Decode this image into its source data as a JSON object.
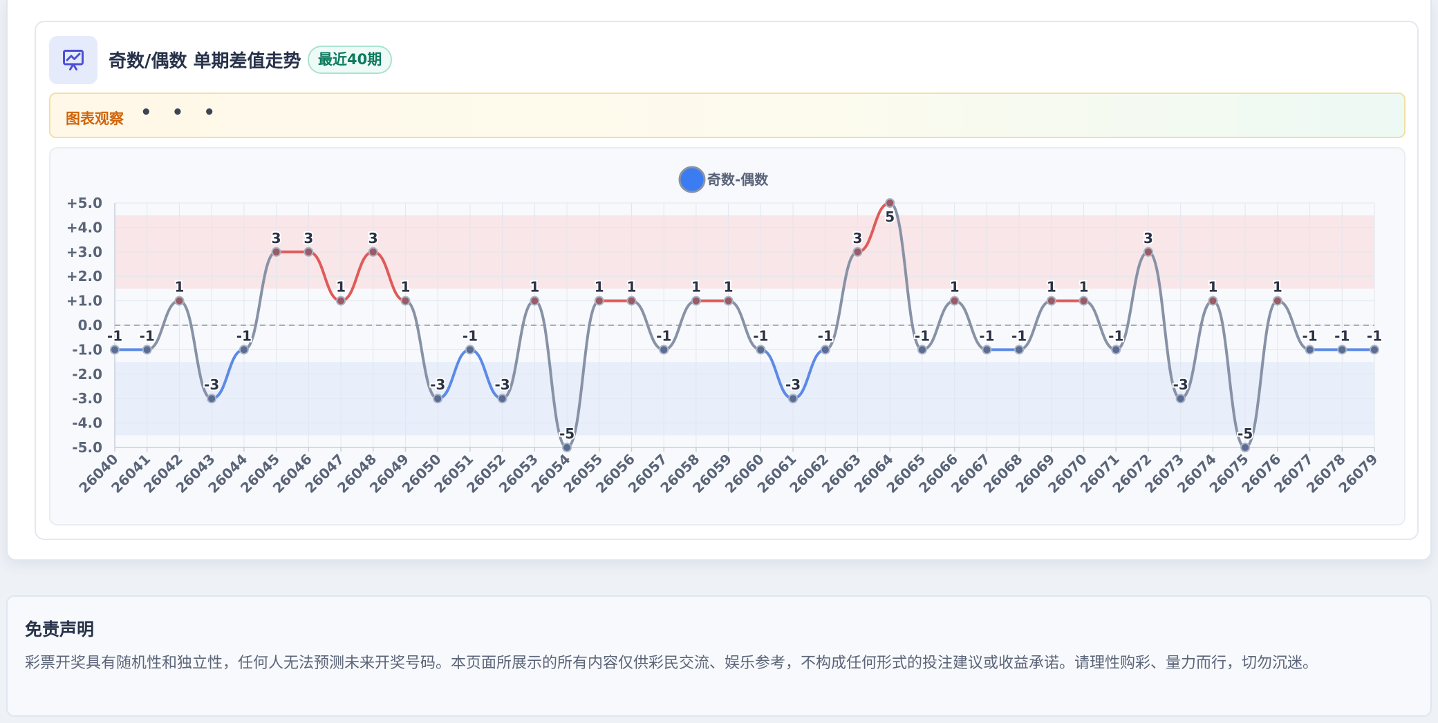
{
  "header": {
    "icon": "presentation-chart-icon",
    "title": "奇数/偶数 单期差值走势",
    "badge": "最近40期"
  },
  "observation": {
    "label": "图表观察",
    "dots": "• • •"
  },
  "colors": {
    "up_line": "#e05a5a",
    "down_line": "#5b8ae6",
    "neutral_line": "#8892a6",
    "legend_dot": "#3b7cf3",
    "high_band": "#f7e3e6",
    "low_band": "#e5ecfa"
  },
  "chart_data": {
    "type": "line",
    "legend": [
      "奇数-偶数"
    ],
    "legend_position": "top-center",
    "x": [
      "26040",
      "26041",
      "26042",
      "26043",
      "26044",
      "26045",
      "26046",
      "26047",
      "26048",
      "26049",
      "26050",
      "26051",
      "26052",
      "26053",
      "26054",
      "26055",
      "26056",
      "26057",
      "26058",
      "26059",
      "26060",
      "26061",
      "26062",
      "26063",
      "26064",
      "26065",
      "26066",
      "26067",
      "26068",
      "26069",
      "26070",
      "26071",
      "26072",
      "26073",
      "26074",
      "26075",
      "26076",
      "26077",
      "26078",
      "26079"
    ],
    "series": [
      {
        "name": "奇数-偶数",
        "values": [
          -1,
          -1,
          1,
          -3,
          -1,
          3,
          3,
          1,
          3,
          1,
          -3,
          -1,
          -3,
          1,
          -5,
          1,
          1,
          -1,
          1,
          1,
          -1,
          -3,
          -1,
          3,
          5,
          -1,
          1,
          -1,
          -1,
          1,
          1,
          -1,
          3,
          -3,
          1,
          -5,
          1,
          -1,
          -1,
          -1
        ]
      }
    ],
    "y_ticks": [
      "+5.0",
      "+4.0",
      "+3.0",
      "+2.0",
      "+1.0",
      "0.0",
      "-1.0",
      "-2.0",
      "-3.0",
      "-4.0",
      "-5.0"
    ],
    "ylim": [
      -5,
      5
    ],
    "bands": [
      {
        "from": 1.5,
        "to": 4.5,
        "kind": "high"
      },
      {
        "from": -4.5,
        "to": -1.5,
        "kind": "low"
      }
    ],
    "zero_line": true,
    "grid": true
  },
  "disclaimer": {
    "title": "免责声明",
    "text": "彩票开奖具有随机性和独立性，任何人无法预测未来开奖号码。本页面所展示的所有内容仅供彩民交流、娱乐参考，不构成任何形式的投注建议或收益承诺。请理性购彩、量力而行，切勿沉迷。"
  }
}
